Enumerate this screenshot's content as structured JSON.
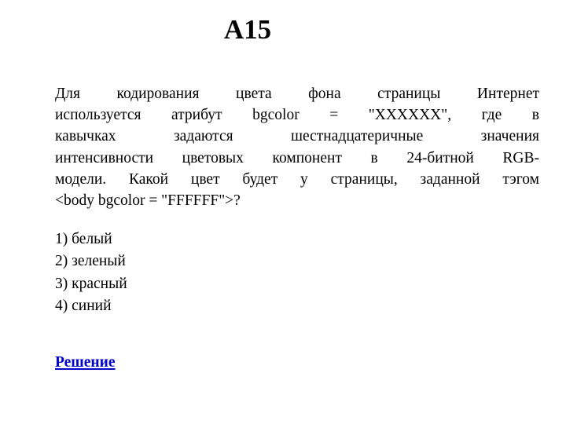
{
  "document": {
    "background_color": "#FFFFFF",
    "text_color": "#000000",
    "title": "A15"
  },
  "question": {
    "full_text": "Для кодирования цвета фона страницы Интернет используется атрибут bgcolor = \"XXXXXX\", где в кавычках задаются шестнадцатеричные значения интенсивности цветовых компонент в 24-битной RGB-модели. Какой цвет будет у страницы, заданной тэгом <body bgcolor = \"FFFFFF\">?",
    "lines": [
      "Для кодирования цвета фона страницы Интернет",
      "используется атрибут bgcolor = \"XXXXXX\", где в",
      "кавычках задаются шестнадцатеричные значения",
      "интенсивности цветовых компонент в 24-битной RGB-",
      "модели. Какой цвет будет у страницы, заданной тэгом",
      "<body bgcolor = \"FFFFFF\">?"
    ]
  },
  "options": [
    {
      "label": "1) белый"
    },
    {
      "label": "2) зеленый"
    },
    {
      "label": "3) красный"
    },
    {
      "label": "4) синий"
    }
  ],
  "solution": {
    "label": "Решение",
    "color": "#0000CC"
  }
}
